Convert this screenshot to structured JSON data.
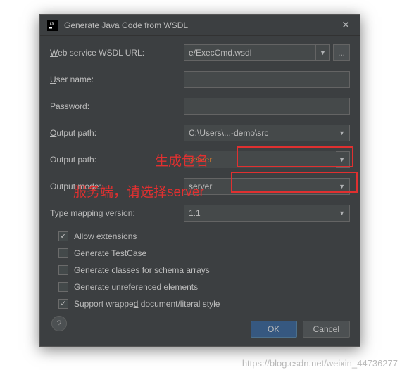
{
  "dialog": {
    "title": "Generate Java Code from WSDL"
  },
  "fields": {
    "wsdl_url": {
      "label_pre": "W",
      "label_post": "eb service WSDL URL:",
      "value": "e/ExecCmd.wsdl"
    },
    "username": {
      "label_pre": "U",
      "label_post": "ser name:",
      "value": ""
    },
    "password": {
      "label_pre": "P",
      "label_post": "assword:",
      "value": ""
    },
    "output_path": {
      "label_pre": "O",
      "label_post": "utput path:",
      "value": "C:\\Users\\...-demo\\src"
    },
    "output_package": {
      "label": "Output path:",
      "value": "server"
    },
    "output_mode": {
      "label": "Output mode:",
      "value": "server"
    },
    "type_mapping": {
      "label_pre": "Type mapping ",
      "label_mn": "v",
      "label_post": "ersion:",
      "value": "1.1"
    }
  },
  "checkboxes": {
    "allow_ext": {
      "label": "Allow extensions",
      "checked": true
    },
    "gen_testcase": {
      "label_pre": "G",
      "label_post": "enerate TestCase",
      "checked": false
    },
    "gen_schema": {
      "label_pre": "G",
      "label_post": "enerate classes for schema arrays",
      "checked": false
    },
    "gen_unref": {
      "label_pre": "G",
      "label_post": "enerate unreferenced elements",
      "checked": false
    },
    "support_wrapped": {
      "label_pre": "Support wrappe",
      "label_mn": "d",
      "label_post": " document/literal style",
      "checked": true
    }
  },
  "buttons": {
    "ok": "OK",
    "cancel": "Cancel",
    "help": "?",
    "browse": "..."
  },
  "annotations": {
    "a1": "生成包名",
    "a2": "服务端，请选择server"
  },
  "watermark": "https://blog.csdn.net/weixin_44736277"
}
